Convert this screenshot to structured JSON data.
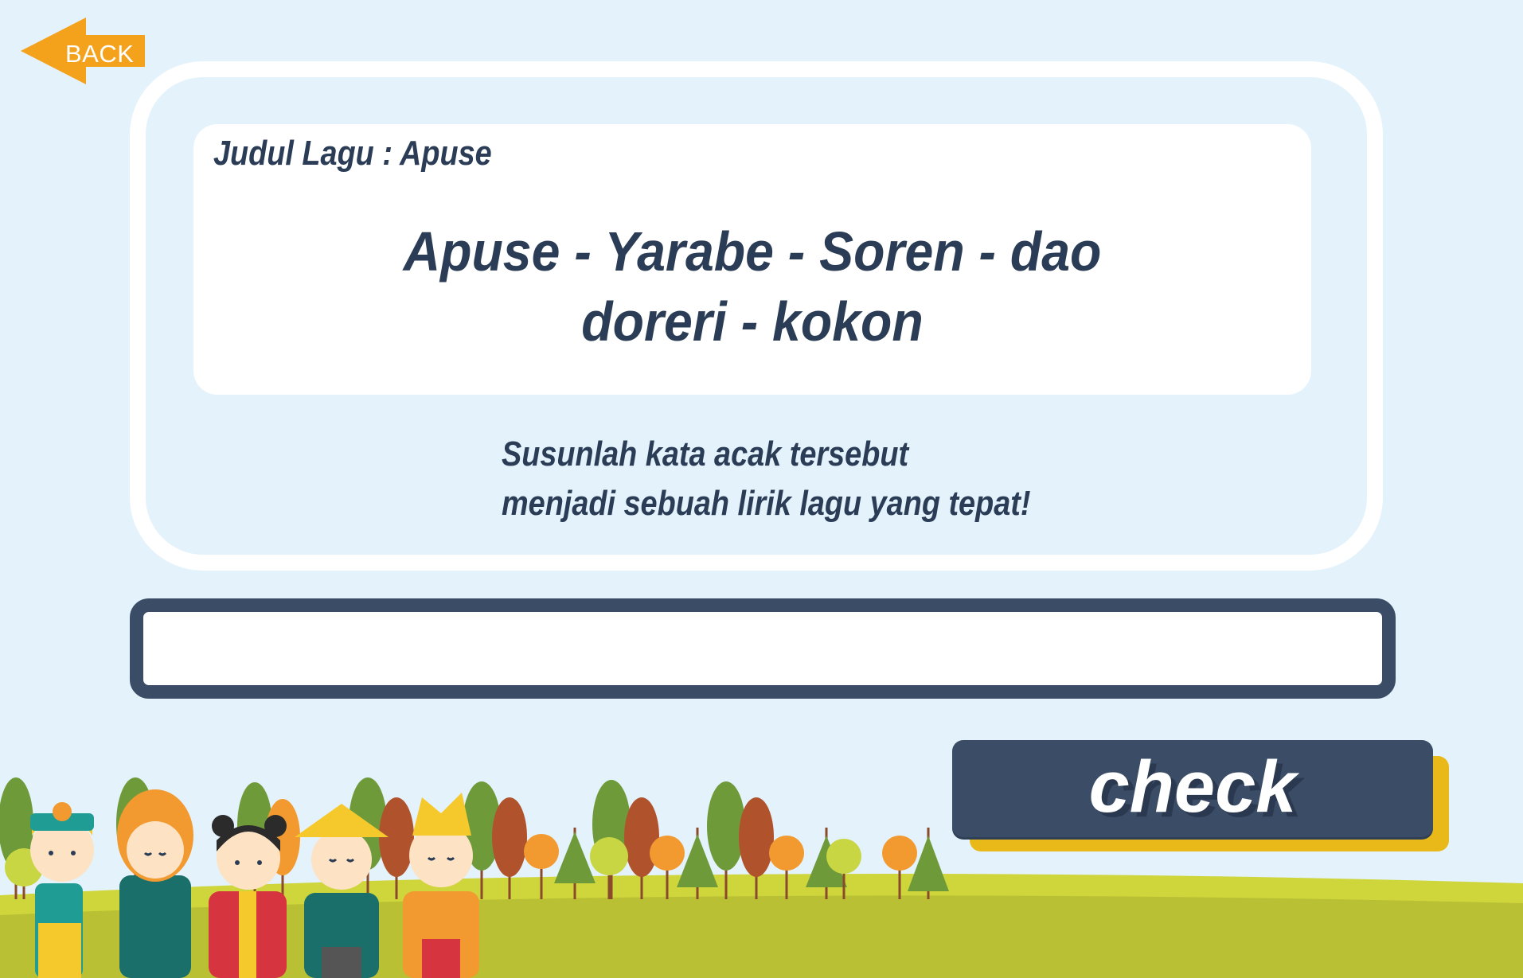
{
  "nav": {
    "back_label": "BACK"
  },
  "song": {
    "title": "Judul Lagu : Apuse",
    "scrambled_line1": "Apuse - Yarabe - Soren - dao",
    "scrambled_line2": "doreri - kokon"
  },
  "instruction": {
    "line1": "Susunlah kata acak tersebut",
    "line2": "menjadi sebuah lirik lagu yang tepat!"
  },
  "answer": {
    "value": "",
    "placeholder": ""
  },
  "actions": {
    "check_label": "check"
  },
  "colors": {
    "background": "#e3f2fb",
    "navy": "#3b4d66",
    "text": "#2b3d56",
    "accent_orange": "#f4a21b",
    "accent_yellow": "#e8b918",
    "grass": "#b9c034"
  }
}
